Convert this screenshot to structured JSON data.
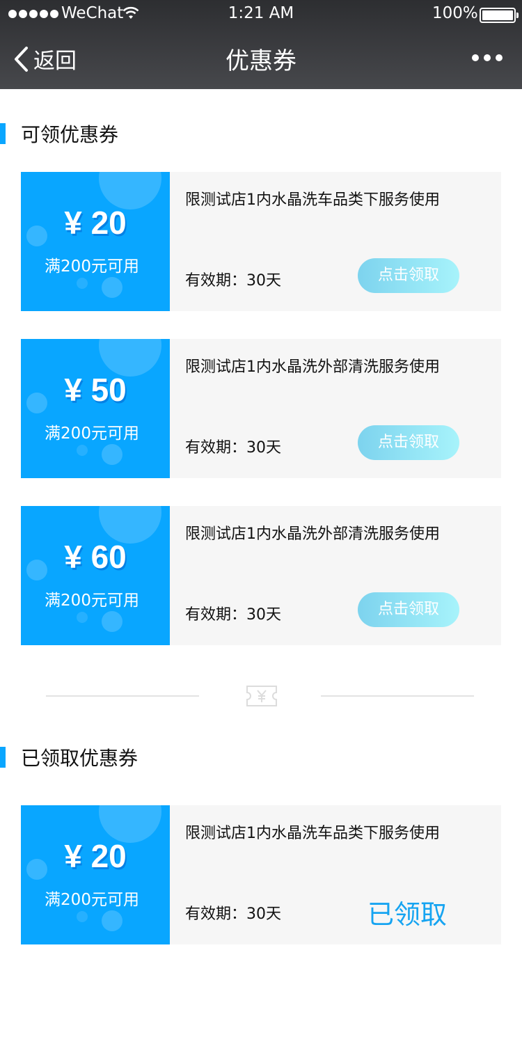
{
  "status_bar": {
    "carrier": "WeChat",
    "time": "1:21 AM",
    "battery": "100%"
  },
  "nav": {
    "back_label": "返回",
    "title": "优惠券"
  },
  "available": {
    "title": "可领优惠券",
    "coupons": [
      {
        "amount": "¥ 20",
        "condition": "满200元可用",
        "description": "限测试店1内水晶洗车品类下服务使用",
        "validity": "有效期：30天",
        "action": "点击领取"
      },
      {
        "amount": "¥ 50",
        "condition": "满200元可用",
        "description": "限测试店1内水晶洗外部清洗服务使用",
        "validity": "有效期：30天",
        "action": "点击领取"
      },
      {
        "amount": "¥ 60",
        "condition": "满200元可用",
        "description": "限测试店1内水晶洗外部清洗服务使用",
        "validity": "有效期：30天",
        "action": "点击领取"
      }
    ]
  },
  "divider_icon": "ticket-yen-icon",
  "claimed": {
    "title": "已领取优惠券",
    "coupons": [
      {
        "amount": "¥ 20",
        "condition": "满200元可用",
        "description": "限测试店1内水晶洗车品类下服务使用",
        "validity": "有效期：30天",
        "status": "已领取"
      }
    ]
  },
  "colors": {
    "accent": "#09a6ff",
    "claimed_text": "#16a4f1",
    "card_bg": "#f6f6f6",
    "header_bg": "#3a3b3e"
  }
}
